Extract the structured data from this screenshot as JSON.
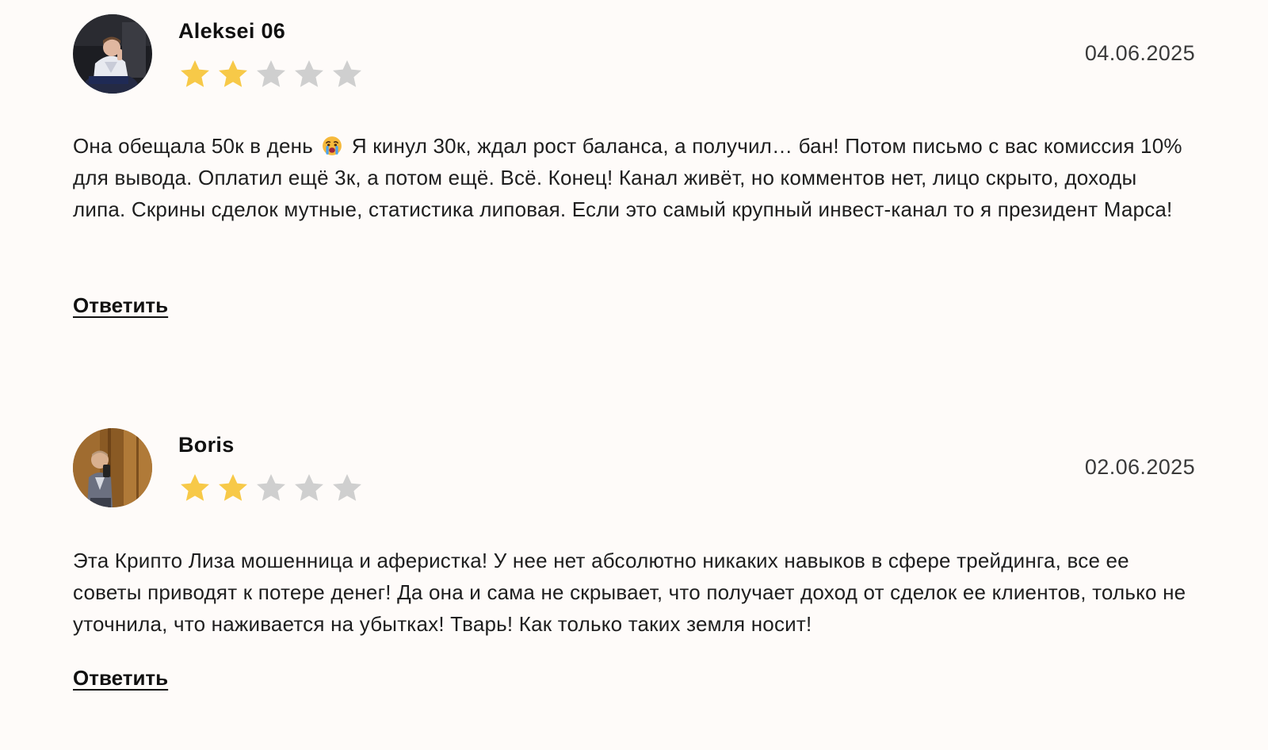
{
  "reviews": [
    {
      "author": "Aleksei 06",
      "date": "04.06.2025",
      "rating": 2,
      "max_rating": 5,
      "text_before_emoji": "Она обещала 50к в день",
      "emoji": "crying-face-emoji",
      "text_after_emoji": "Я кинул 30к, ждал рост баланса, а получил… бан! Потом письмо с вас комиссия 10% для вывода. Оплатил ещё 3к, а потом ещё. Всё. Конец! Канал живёт, но комментов нет, лицо скрыто, доходы липа. Скрины сделок мутные, статистика липовая. Если это самый крупный инвест-канал то я президент Марса!",
      "reply_label": "Ответить"
    },
    {
      "author": "Boris",
      "date": "02.06.2025",
      "rating": 2,
      "max_rating": 5,
      "text": "Эта Крипто Лиза мошенница и аферистка! У нее нет абсолютно никаких навыков в сфере трейдинга, все ее советы приводят к потере денег! Да она и сама не скрывает, что получает доход от сделок ее клиентов, только не уточнила, что наживается на убытках! Тварь! Как только таких земля носит!",
      "reply_label": "Ответить"
    }
  ],
  "colors": {
    "background": "#fefbf9",
    "star_filled": "#f7c948",
    "star_empty": "#cfcfcf",
    "text": "#1e1e1e"
  }
}
